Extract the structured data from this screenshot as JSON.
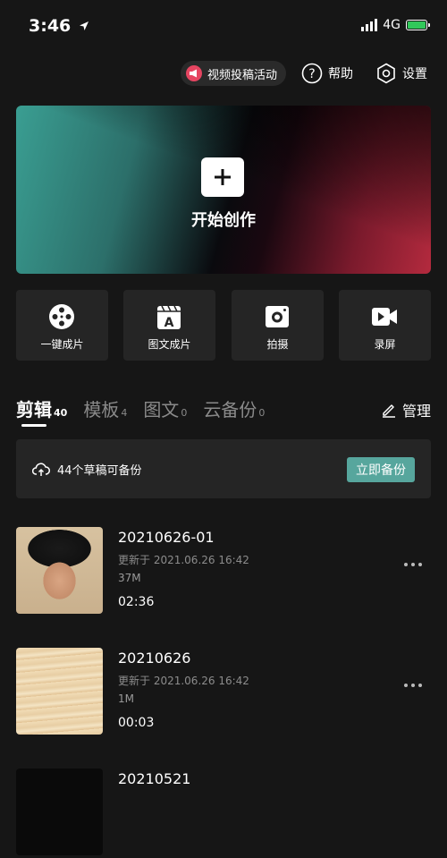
{
  "status_bar": {
    "time": "3:46",
    "network": "4G"
  },
  "header": {
    "promo_label": "视频投稿活动",
    "help_label": "帮助",
    "settings_label": "设置"
  },
  "hero": {
    "label": "开始创作"
  },
  "tools": [
    {
      "label": "一键成片",
      "icon": "film-reel-icon"
    },
    {
      "label": "图文成片",
      "icon": "text-clapper-icon"
    },
    {
      "label": "拍摄",
      "icon": "camera-icon"
    },
    {
      "label": "录屏",
      "icon": "video-record-icon"
    }
  ],
  "tabs": [
    {
      "label": "剪辑",
      "count": "40",
      "active": true
    },
    {
      "label": "模板",
      "count": "4"
    },
    {
      "label": "图文",
      "count": "0"
    },
    {
      "label": "云备份",
      "count": "0"
    }
  ],
  "manage_label": "管理",
  "backup": {
    "text": "44个草稿可备份",
    "button": "立即备份"
  },
  "drafts": [
    {
      "title": "20210626-01",
      "updated": "更新于 2021.06.26 16:42",
      "size": "37M",
      "duration": "02:36"
    },
    {
      "title": "20210626",
      "updated": "更新于 2021.06.26 16:42",
      "size": "1M",
      "duration": "00:03"
    },
    {
      "title": "20210521"
    }
  ],
  "colors": {
    "background": "#161616",
    "card": "#252525",
    "accent": "#57a69d",
    "promo": "#e64561"
  }
}
